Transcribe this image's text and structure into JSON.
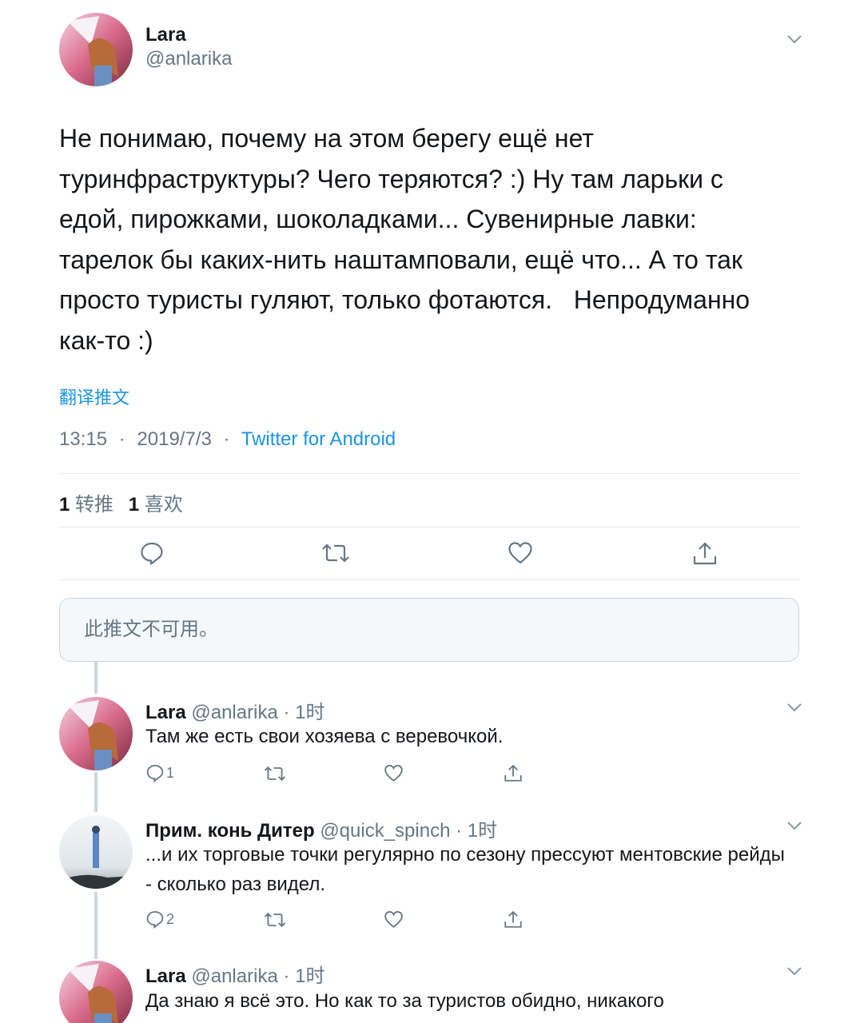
{
  "main_tweet": {
    "name": "Lara",
    "handle": "@anlarika",
    "text": "Не понимаю, почему на этом берегу ещё нет\nтуринфраструктуры? Чего теряются? :) Ну там ларьки с\nедой, пирожками, шоколадками... Сувенирные лавки:\nтарелок бы каких-нить наштамповали, ещё что... А то так\nпросто туристы гуляют, только фотаются.   Непродуманно\nкак-то :)",
    "translate": "翻译推文",
    "time": "13:15",
    "date": "2019/7/3",
    "separator": "·",
    "source": "Twitter for Android",
    "retweet_count": "1",
    "retweet_label": "转推",
    "like_count": "1",
    "like_label": "喜欢"
  },
  "quoted_unavailable": "此推文不可用。",
  "replies": [
    {
      "name": "Lara",
      "handle": "@anlarika",
      "time": "· 1时",
      "text": "Там же есть свои хозяева с веревочкой.",
      "reply_count": "1"
    },
    {
      "name": "Прим. конь Дитер",
      "handle": "@quick_spinch",
      "time": "· 1时",
      "text": "...и их торговые точки регулярно по сезону прессуют ментовские рейды - сколько раз видел.",
      "reply_count": "2"
    },
    {
      "name": "Lara",
      "handle": "@anlarika",
      "time": "· 1时",
      "text": "Да знаю я всё это. Но как то за туристов обидно, никакого"
    }
  ],
  "icons": {
    "reply": "reply-icon",
    "retweet": "retweet-icon",
    "like": "heart-icon",
    "share": "share-icon",
    "caret": "chevron-down-icon"
  },
  "colors": {
    "link": "#1b95e0",
    "secondary_text": "#657786",
    "divider": "#e1e8ed",
    "icon": "#657786"
  }
}
